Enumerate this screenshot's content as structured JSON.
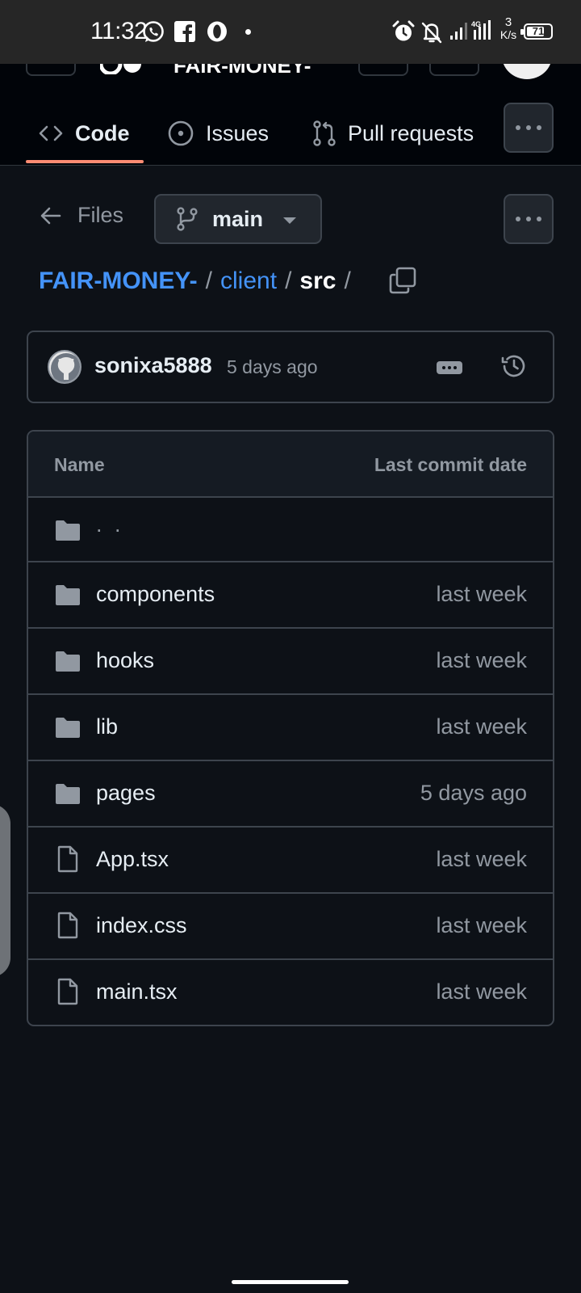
{
  "status_bar": {
    "time": "11:32",
    "network_speed_value": "3",
    "network_speed_unit": "K/s",
    "network_type": "4G",
    "battery": "71",
    "icons": [
      "whatsapp-icon",
      "facebook-icon",
      "opera-icon",
      "alarm-icon",
      "notifications-off-icon",
      "signal-icon"
    ]
  },
  "header": {
    "repo_name_partial": "FAIR-MONEY-"
  },
  "tabs": [
    {
      "label": "Code",
      "icon": "code-icon",
      "active": true
    },
    {
      "label": "Issues",
      "icon": "issue-opened-icon"
    },
    {
      "label": "Pull requests",
      "icon": "git-pull-request-icon"
    }
  ],
  "files_nav": {
    "back_label": "Files",
    "branch": "main"
  },
  "breadcrumb": {
    "repo": "FAIR-MONEY-",
    "folder": "client",
    "current": "src",
    "separator": "/"
  },
  "latest_commit": {
    "author": "sonixa5888",
    "time": "5 days ago"
  },
  "table": {
    "col_name": "Name",
    "col_date": "Last commit date",
    "parent_label": ". .",
    "rows": [
      {
        "name": "components",
        "date": "last week",
        "type": "folder"
      },
      {
        "name": "hooks",
        "date": "last week",
        "type": "folder"
      },
      {
        "name": "lib",
        "date": "last week",
        "type": "folder"
      },
      {
        "name": "pages",
        "date": "5 days ago",
        "type": "folder"
      },
      {
        "name": "App.tsx",
        "date": "last week",
        "type": "file"
      },
      {
        "name": "index.css",
        "date": "last week",
        "type": "file"
      },
      {
        "name": "main.tsx",
        "date": "last week",
        "type": "file"
      }
    ]
  },
  "colors": {
    "background": "#0d1117",
    "link": "#4493f8",
    "active_tab_underline": "#fd8c73",
    "border": "#3d444d",
    "muted": "#9198a1"
  }
}
